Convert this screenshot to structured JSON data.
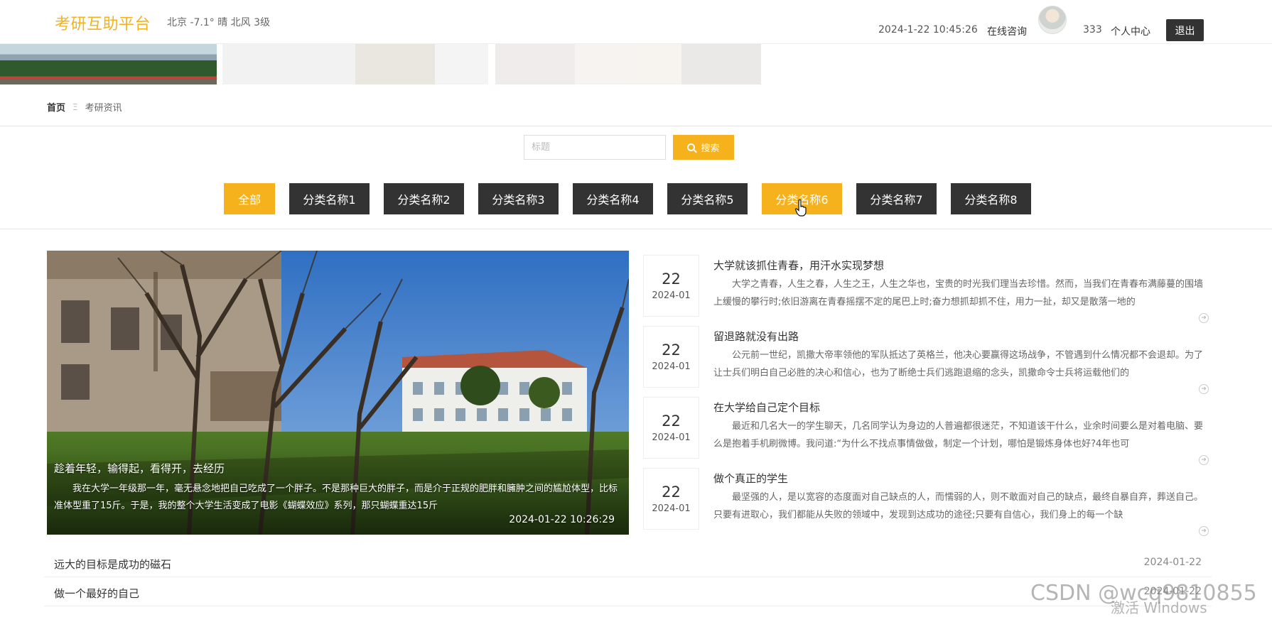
{
  "header": {
    "brand": "考研互助平台",
    "weather": "北京  -7.1°  晴  北风  3级",
    "datetime": "2024-1-22 10:45:26",
    "consult": "在线咨询",
    "username": "333",
    "user_center": "个人中心",
    "logout": "退出"
  },
  "breadcrumb": {
    "home": "首页",
    "separator": "Ξ",
    "current": "考研资讯"
  },
  "search": {
    "placeholder": "标题",
    "button": "搜索"
  },
  "categories": [
    "全部",
    "分类名称1",
    "分类名称2",
    "分类名称3",
    "分类名称4",
    "分类名称5",
    "分类名称6",
    "分类名称7",
    "分类名称8"
  ],
  "active_category": "全部",
  "hover_category": "分类名称6",
  "featured": {
    "title": "趁着年轻，输得起，看得开，去经历",
    "desc": "我在大学一年级那一年，毫无悬念地把自己吃成了一个胖子。不是那种巨大的胖子，而是介于正规的肥胖和臃肿之间的尴尬体型，比标准体型重了15斤。于是，我的整个大学生活变成了电影《蝴蝶效应》系列，那只蝴蝶重达15斤",
    "time": "2024-01-22 10:26:29"
  },
  "news": [
    {
      "day": "22",
      "ym": "2024-01",
      "title": "大学就该抓住青春，用汗水实现梦想",
      "desc": "大学之青春，人生之春，人生之王，人生之华也，宝贵的时光我们理当去珍惜。然而，当我们在青春布满藤蔓的围墙上缓慢的攀行时;依旧游离在青春摇摆不定的尾巴上时;奋力想抓却抓不住，用力一扯，却又是散落一地的"
    },
    {
      "day": "22",
      "ym": "2024-01",
      "title": "留退路就没有出路",
      "desc": "公元前一世纪，凯撒大帝率领他的军队抵达了英格兰，他决心要赢得这场战争，不管遇到什么情况都不会退却。为了让士兵们明白自己必胜的决心和信心，也为了断绝士兵们逃跑退缩的念头，凯撒命令士兵将运载他们的"
    },
    {
      "day": "22",
      "ym": "2024-01",
      "title": "在大学给自己定个目标",
      "desc": "最近和几名大一的学生聊天，几名同学认为身边的人普遍都很迷茫，不知道该干什么，业余时间要么是对着电脑、要么是抱着手机刷微博。我问道:“为什么不找点事情做做，制定一个计划，哪怕是锻炼身体也好?4年也可"
    },
    {
      "day": "22",
      "ym": "2024-01",
      "title": "做个真正的学生",
      "desc": "最坚强的人，是以宽容的态度面对自己缺点的人，而懦弱的人，则不敢面对自己的缺点，最终自暴自弃，葬送自己。只要有进取心，我们都能从失败的领域中，发现到达成功的途径;只要有自信心，我们身上的每一个缺"
    }
  ],
  "more_icon": "arrow-circle-icon",
  "bottom_list": [
    {
      "title": "远大的目标是成功的磁石",
      "date": "2024-01-22"
    },
    {
      "title": "做一个最好的自己",
      "date": "2024-01-22"
    }
  ],
  "watermark": {
    "csdn": "CSDN @wcq9810855",
    "windows": "激活 Windows"
  },
  "colors": {
    "accent": "#f5b21c",
    "dark_button": "#333333"
  }
}
